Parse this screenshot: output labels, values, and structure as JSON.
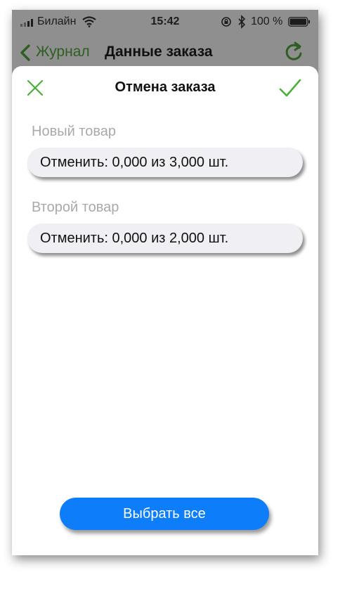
{
  "status_bar": {
    "carrier": "Билайн",
    "time": "15:42",
    "battery_percent": "100 %"
  },
  "navbar": {
    "back_label": "Журнал",
    "title": "Данные заказа"
  },
  "sheet": {
    "title": "Отмена заказа",
    "items": [
      {
        "name": "Новый товар",
        "cancel_text": "Отменить: 0,000 из 3,000 шт."
      },
      {
        "name": "Второй товар",
        "cancel_text": "Отменить: 0,000 из 2,000 шт."
      }
    ],
    "select_all_label": "Выбрать все"
  },
  "colors": {
    "accent_green": "#4caf3a",
    "button_blue": "#0d7dfa",
    "overlay_gray": "#8f8f8f"
  },
  "icons": {
    "back": "chevron-left-icon",
    "refresh": "refresh-icon",
    "close": "close-icon",
    "confirm": "checkmark-icon"
  }
}
